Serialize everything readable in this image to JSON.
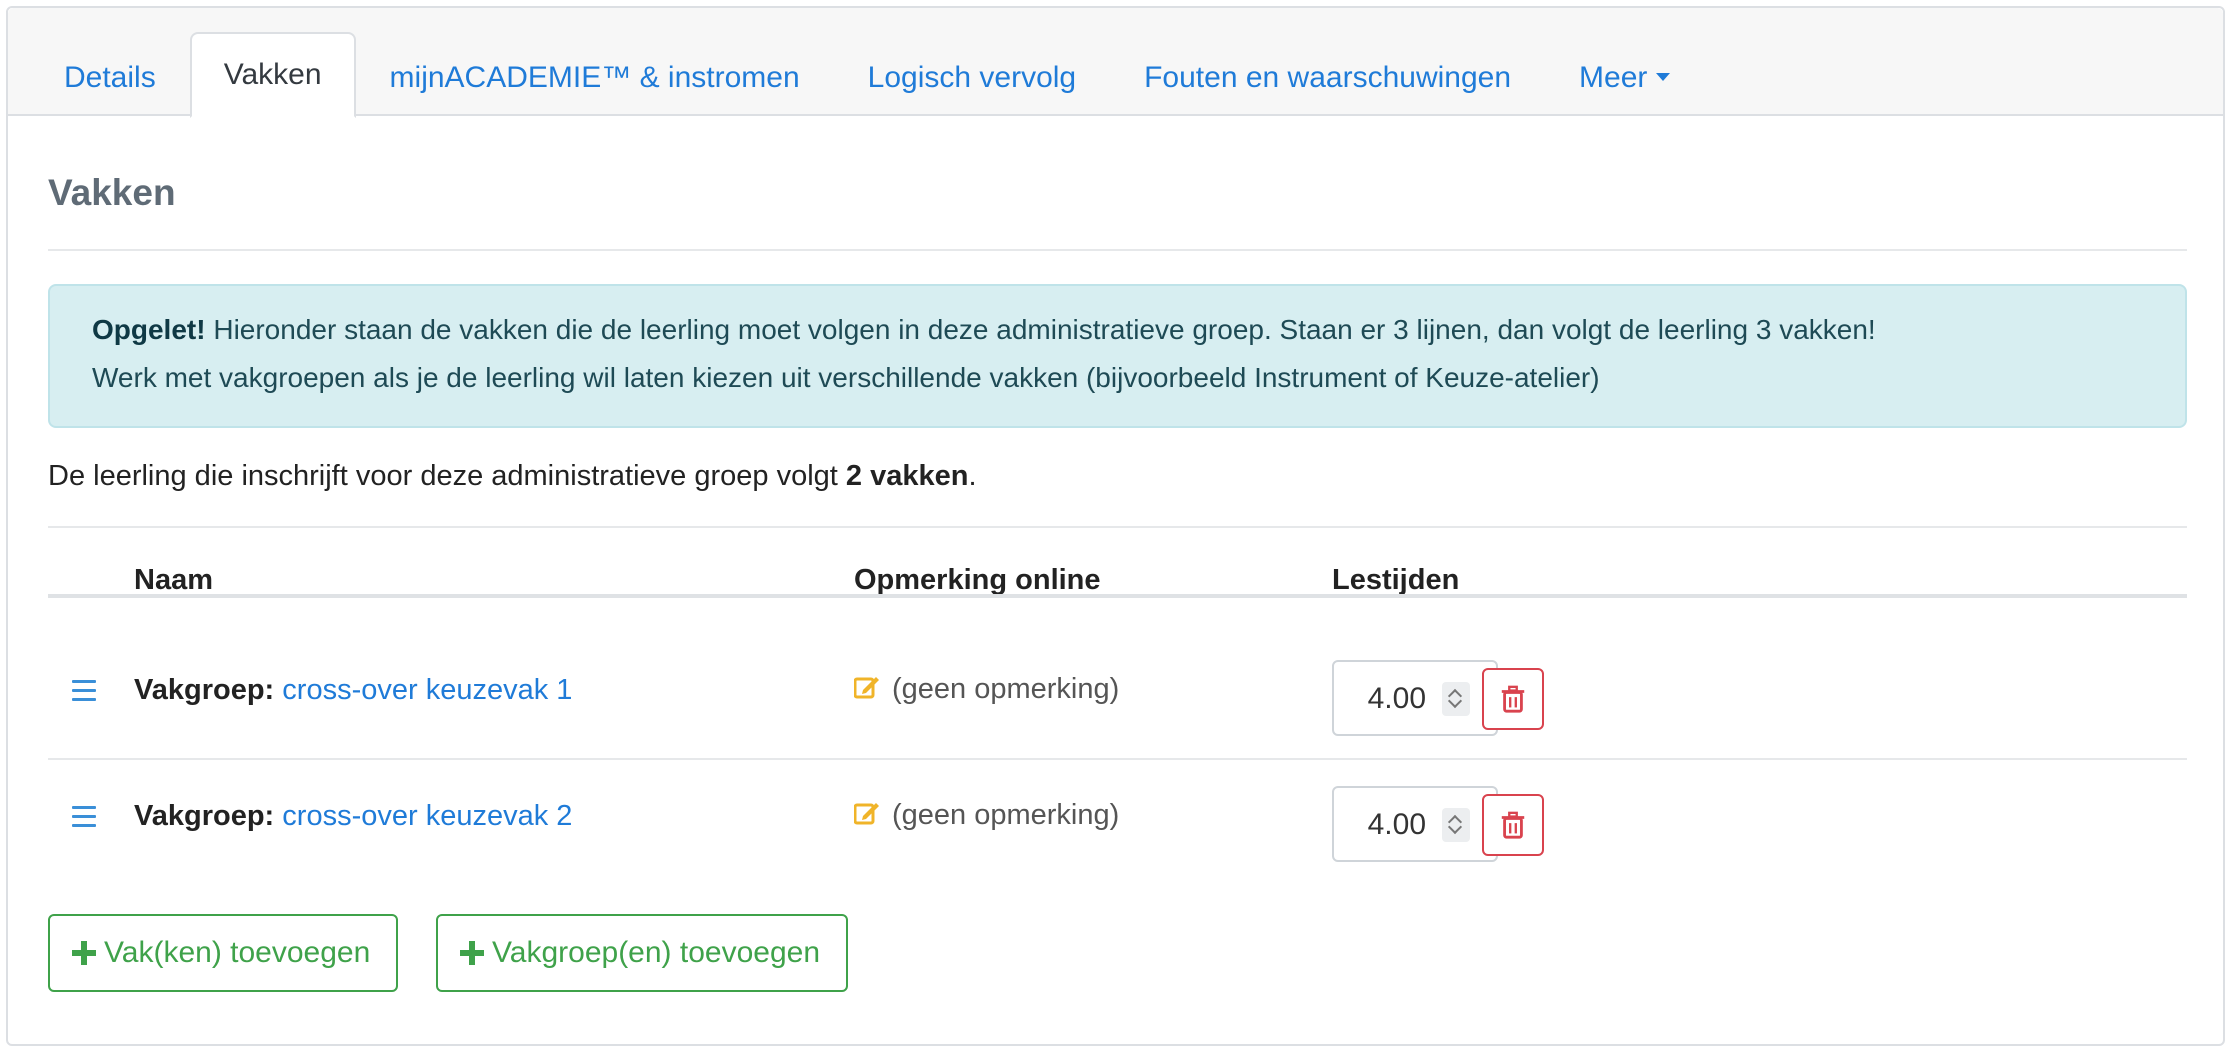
{
  "tabs": [
    {
      "label": "Details"
    },
    {
      "label": "Vakken"
    },
    {
      "label": "mijnACADEMIE™ & instromen"
    },
    {
      "label": "Logisch vervolg"
    },
    {
      "label": "Fouten en waarschuwingen"
    },
    {
      "label": "Meer"
    }
  ],
  "section_title": "Vakken",
  "alert": {
    "strong": "Opgelet!",
    "line1": " Hieronder staan de vakken die de leerling moet volgen in deze administratieve groep. Staan er 3 lijnen, dan volgt de leerling 3 vakken!",
    "line2": "Werk met vakgroepen als je de leerling wil laten kiezen uit verschillende vakken (bijvoorbeeld Instrument of Keuze-atelier)"
  },
  "summary": {
    "prefix": "De leerling die inschrijft voor deze administratieve groep volgt ",
    "count": "2 vakken",
    "suffix": "."
  },
  "table": {
    "headers": {
      "name": "Naam",
      "remark": "Opmerking online",
      "hours": "Lestijden"
    },
    "rows": [
      {
        "prefix": "Vakgroep:",
        "link": "cross-over keuzevak 1",
        "remark": "(geen opmerking)",
        "hours": "4.00"
      },
      {
        "prefix": "Vakgroep:",
        "link": "cross-over keuzevak 2",
        "remark": "(geen opmerking)",
        "hours": "4.00"
      }
    ]
  },
  "buttons": {
    "add_course": "Vak(ken) toevoegen",
    "add_group": "Vakgroep(en) toevoegen"
  },
  "colors": {
    "link": "#1f7bd8",
    "success": "#3fa24a",
    "danger": "#d9434e",
    "edit": "#f0b429"
  }
}
